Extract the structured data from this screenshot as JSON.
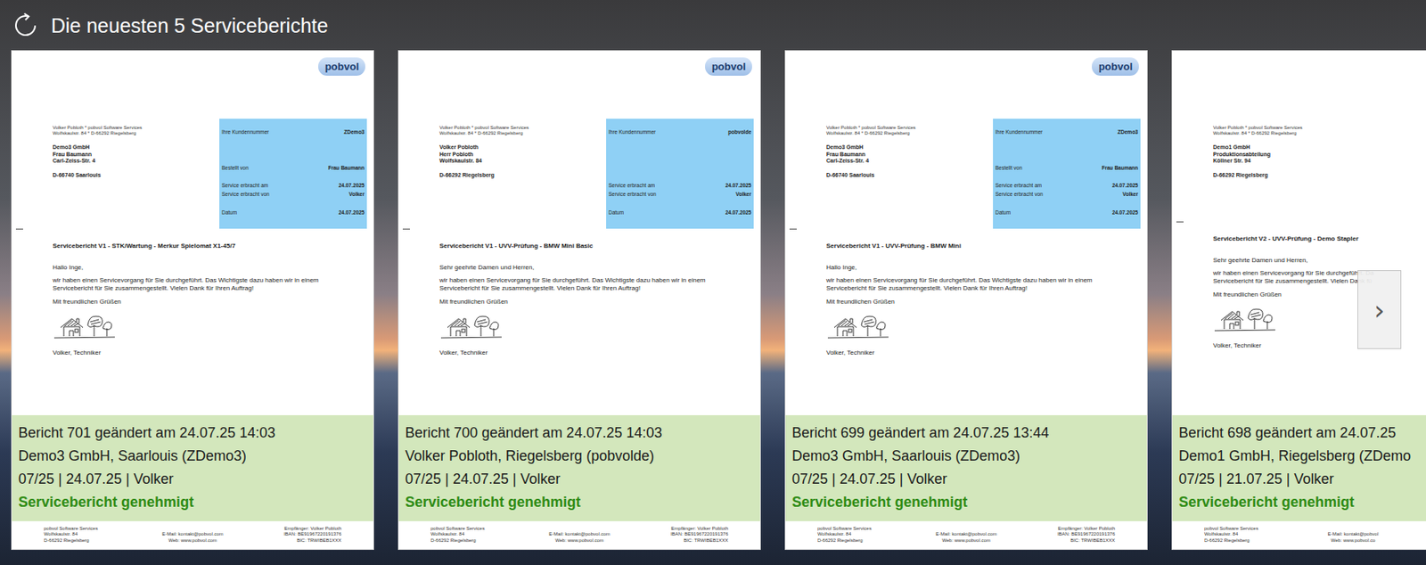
{
  "header": {
    "title": "Die neuesten 5 Serviceberichte"
  },
  "reports": [
    {
      "logo": "pobvol",
      "sender": [
        "Volker Pobloth * pobvol Software Services",
        "Wolfskaulstr. 84 * D-66292 Riegelsberg"
      ],
      "address": [
        "Demo3 GmbH",
        "Frau Baumann",
        "Carl-Zeiss-Str. 4"
      ],
      "city": "D-66740 Saarlouis",
      "info_groups": [
        [
          {
            "label": "Ihre Kundennummer",
            "value": "ZDemo3"
          }
        ],
        [
          {
            "label": "Bestellt von",
            "value": "Frau Baumann"
          }
        ],
        [
          {
            "label": "Service erbracht am",
            "value": "24.07.2025"
          },
          {
            "label": "Service erbracht von",
            "value": "Volker"
          }
        ],
        [
          {
            "label": "Datum",
            "value": "24.07.2025"
          }
        ]
      ],
      "subject": "Servicebericht V1 - STK/Wartung - Merkur Spielomat X1-45/7",
      "greeting": "Hallo Inge,",
      "body": [
        "wir haben einen Servicevorgang für Sie durchgeführt. Das Wichtigste dazu haben wir in einem",
        "Servicebericht für Sie zusammengestellt. Vielen Dank für Ihren Auftrag!"
      ],
      "closing": "Mit freundlichen Grüßen",
      "signature": "Volker, Techniker",
      "footer": [
        [
          "pobvol Software Services",
          "Wolfskaulstr. 84",
          "D-66292 Riegelsberg"
        ],
        [
          "E-Mail: kontakt@pobvol.com",
          "Web: www.pobvol.com"
        ],
        [
          "Empfänger: Volker Pobloth",
          "IBAN: BE91967220191376",
          "BIC: TRWIBEB1XXX"
        ]
      ],
      "summary": {
        "title": "Bericht 701 geändert am 24.07.25 14:03",
        "customer": "Demo3 GmbH, Saarlouis (ZDemo3)",
        "meta": "07/25 | 24.07.25 | Volker",
        "status": "Servicebericht genehmigt",
        "approved": true
      }
    },
    {
      "logo": "pobvol",
      "sender": [
        "Volker Pobloth * pobvol Software Services",
        "Wolfskaulstr. 84 * D-66292 Riegelsberg"
      ],
      "address": [
        "Volker Pobloth",
        "Herr Pobloth",
        "Wolfskaulstr. 84"
      ],
      "city": "D-66292 Riegelsberg",
      "info_groups": [
        [
          {
            "label": "Ihre Kundennummer",
            "value": "pobvolde"
          }
        ],
        [],
        [
          {
            "label": "Service erbracht am",
            "value": "24.07.2025"
          },
          {
            "label": "Service erbracht von",
            "value": "Volker"
          }
        ],
        [
          {
            "label": "Datum",
            "value": "24.07.2025"
          }
        ]
      ],
      "subject": "Servicebericht V1 - UVV-Prüfung - BMW Mini Basic",
      "greeting": "Sehr geehrte Damen und Herren,",
      "body": [
        "wir haben einen Servicevorgang für Sie durchgeführt. Das Wichtigste dazu haben wir in einem",
        "Servicebericht für Sie zusammengestellt. Vielen Dank für Ihren Auftrag!"
      ],
      "closing": "Mit freundlichen Grüßen",
      "signature": "Volker, Techniker",
      "footer": [
        [
          "pobvol Software Services",
          "Wolfskaulstr. 84",
          "D-66292 Riegelsberg"
        ],
        [
          "E-Mail: kontakt@pobvol.com",
          "Web: www.pobvol.com"
        ],
        [
          "Empfänger: Volker Pobloth",
          "IBAN: BE91967220191376",
          "BIC: TRWIBEB1XXX"
        ]
      ],
      "summary": {
        "title": "Bericht 700 geändert am 24.07.25 14:03",
        "customer": "Volker Pobloth, Riegelsberg (pobvolde)",
        "meta": "07/25 | 24.07.25 | Volker",
        "status": "Servicebericht genehmigt",
        "approved": true
      }
    },
    {
      "logo": "pobvol",
      "sender": [
        "Volker Pobloth * pobvol Software Services",
        "Wolfskaulstr. 84 * D-66292 Riegelsberg"
      ],
      "address": [
        "Demo3 GmbH",
        "Frau Baumann",
        "Carl-Zeiss-Str. 4"
      ],
      "city": "D-66740 Saarlouis",
      "info_groups": [
        [
          {
            "label": "Ihre Kundennummer",
            "value": "ZDemo3"
          }
        ],
        [
          {
            "label": "Bestellt von",
            "value": "Frau Baumann"
          }
        ],
        [
          {
            "label": "Service erbracht am",
            "value": "24.07.2025"
          },
          {
            "label": "Service erbracht von",
            "value": "Volker"
          }
        ],
        [
          {
            "label": "Datum",
            "value": "24.07.2025"
          }
        ]
      ],
      "subject": "Servicebericht V1 - UVV-Prüfung - BMW Mini",
      "greeting": "Hallo Inge,",
      "body": [
        "wir haben einen Servicevorgang für Sie durchgeführt. Das Wichtigste dazu haben wir in einem",
        "Servicebericht für Sie zusammengestellt. Vielen Dank für Ihren Auftrag!"
      ],
      "closing": "Mit freundlichen Grüßen",
      "signature": "Volker, Techniker",
      "footer": [
        [
          "pobvol Software Services",
          "Wolfskaulstr. 84",
          "D-66292 Riegelsberg"
        ],
        [
          "E-Mail: kontakt@pobvol.com",
          "Web: www.pobvol.com"
        ],
        [
          "Empfänger: Volker Pobloth",
          "IBAN: BE91967220191376",
          "BIC: TRWIBEB1XXX"
        ]
      ],
      "summary": {
        "title": "Bericht 699 geändert am 24.07.25 13:44",
        "customer": "Demo3 GmbH, Saarlouis (ZDemo3)",
        "meta": "07/25 | 24.07.25 | Volker",
        "status": "Servicebericht genehmigt",
        "approved": true
      }
    },
    {
      "sender": [
        "Volker Pobloth * pobvol Software Services",
        "Wolfskaulstr. 84 * D-66292 Riegelsberg"
      ],
      "address": [
        "Demo1 GmbH",
        "Produktionsabteilung",
        "Köllner Str. 94"
      ],
      "city": "D-66292 Riegelsberg",
      "subject": "Servicebericht V2 - UVV-Prüfung - Demo Stapler",
      "greeting": "Sehr geehrte Damen und Herren,",
      "body": [
        "wir haben einen Servicevorgang für Sie durchgeführt. Da",
        "Servicebericht für Sie zusammengestellt. Vielen Dank fü"
      ],
      "closing": "Mit freundlichen Grüßen",
      "signature": "Volker, Techniker",
      "footer": [
        [
          "pobvol Software Services",
          "Wolfskaulstr. 84",
          "D-66292 Riegelsberg"
        ],
        [
          "E-Mail: kontakt@pobvol",
          "Web: www.pobvol.co"
        ]
      ],
      "summary": {
        "title": "Bericht 698 geändert am 24.07.25",
        "customer": "Demo1 GmbH, Riegelsberg (ZDemo",
        "meta": "07/25 | 21.07.25 | Volker",
        "status": "Servicebericht genehmigt",
        "approved": true
      }
    }
  ],
  "next_button": {
    "label": "›"
  }
}
